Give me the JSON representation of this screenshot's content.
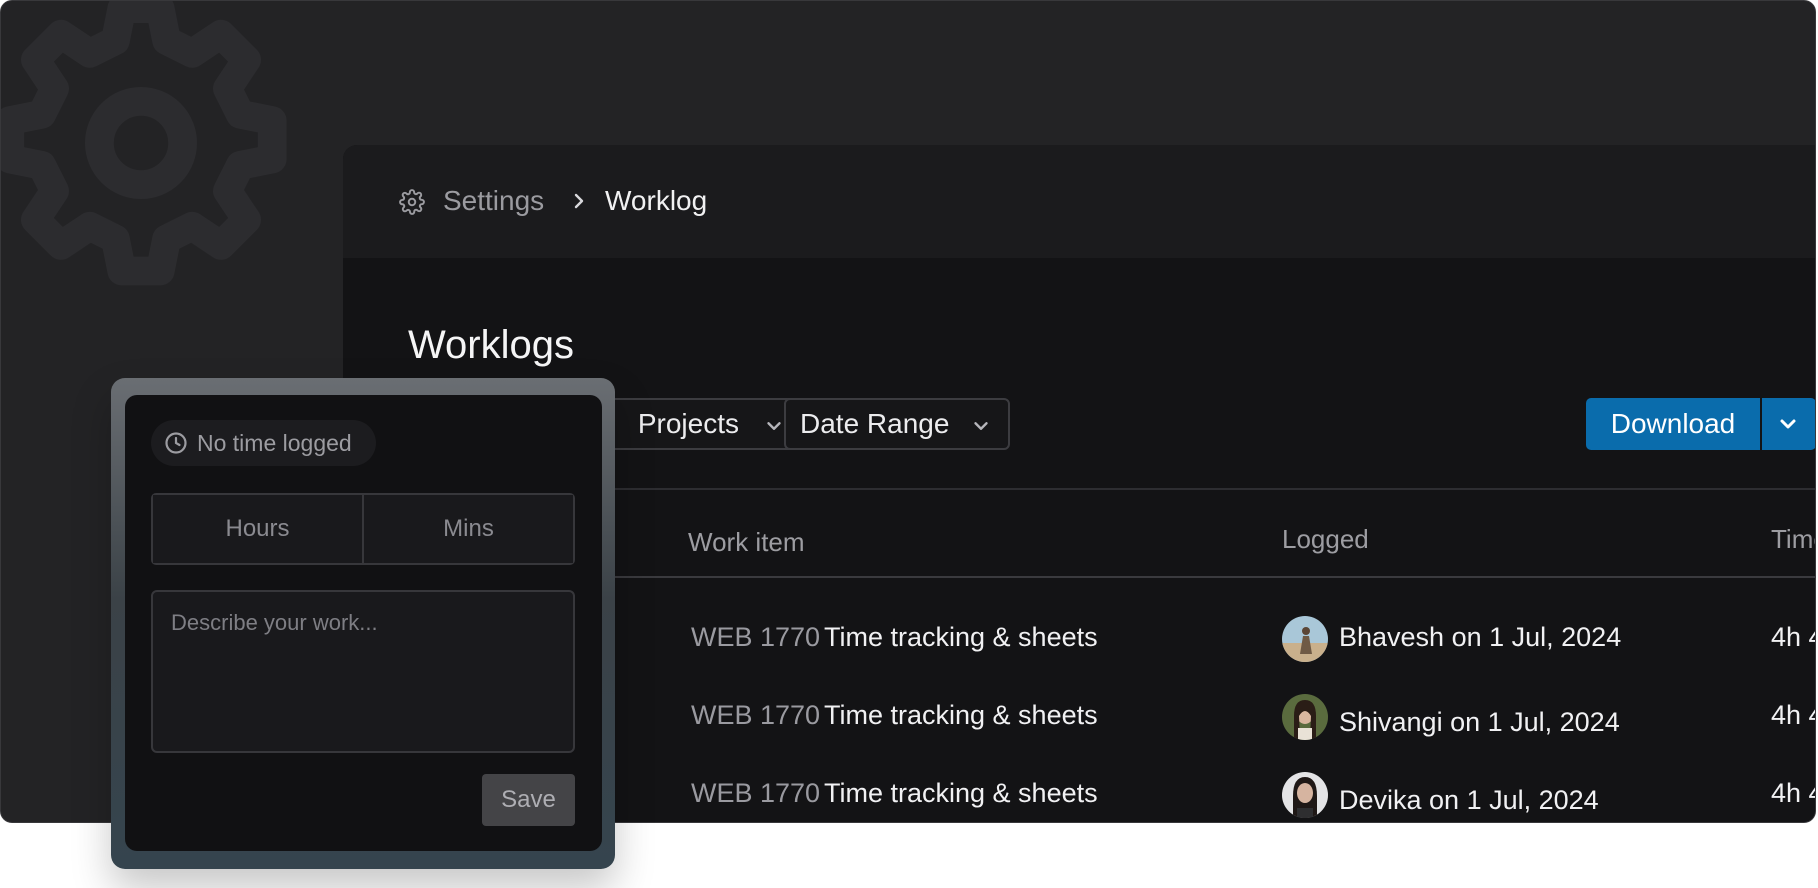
{
  "breadcrumb": {
    "parent": "Settings",
    "current": "Worklog"
  },
  "page": {
    "title": "Worklogs"
  },
  "filters": {
    "projects_label": "Projects",
    "date_range_label": "Date Range"
  },
  "actions": {
    "download_label": "Download"
  },
  "table": {
    "columns": {
      "work_item": "Work item",
      "logged": "Logged",
      "time": "Time"
    },
    "rows": [
      {
        "id": "WEB 1770",
        "title": "Time tracking & sheets",
        "logged": "Bhavesh on 1 Jul, 2024",
        "time": "4h 4"
      },
      {
        "id": "WEB 1770",
        "title": "Time tracking & sheets",
        "logged": "Shivangi on 1 Jul, 2024",
        "time": "4h 4"
      },
      {
        "id": "WEB 1770",
        "title": "Time tracking & sheets",
        "logged": "Devika on 1 Jul, 2024",
        "time": "4h 4"
      }
    ]
  },
  "log_popover": {
    "status": "No time logged",
    "hours_placeholder": "Hours",
    "mins_placeholder": "Mins",
    "description_placeholder": "Describe your work...",
    "save_label": "Save"
  },
  "colors": {
    "accent": "#0a6cac",
    "panel": "#131315",
    "frame": "#232325"
  },
  "icons": [
    "settings-gear-icon",
    "chevron-right-icon",
    "chevron-down-icon",
    "clock-icon",
    "avatar"
  ]
}
